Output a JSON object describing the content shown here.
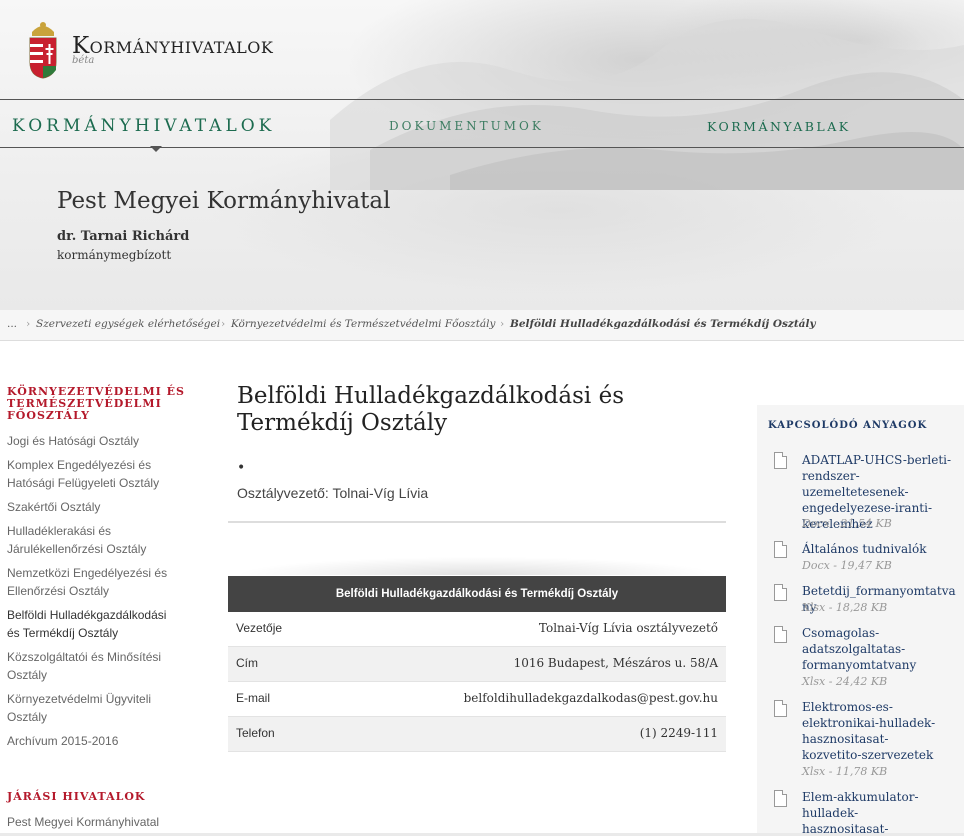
{
  "brand": {
    "name": "Kormányhivatalok",
    "beta": "béta"
  },
  "nav": {
    "items": [
      "Kormányhivatalok",
      "Dokumentumok",
      "Kormányablak"
    ]
  },
  "office": {
    "title": "Pest Megyei Kormányhivatal",
    "head": "dr. Tarnai Richárd",
    "role": "kormánymegbízott"
  },
  "breadcrumb": {
    "items": [
      "...",
      "Szervezeti egységek elérhetőségei",
      "Környezetvédelmi és Természetvédelmi Főosztály",
      "Belföldi Hulladékgazdálkodási és Termékdíj Osztály"
    ]
  },
  "sidebar": {
    "title_lines": [
      "Környezetvédelmi és",
      "Természetvédelmi",
      "Főosztály"
    ],
    "items": [
      {
        "label": "Jogi és Hatósági Osztály"
      },
      {
        "label": "Komplex Engedélyezési és Hatósági Felügyeleti Osztály"
      },
      {
        "label": "Szakértői Osztály"
      },
      {
        "label": "Hulladéklerakási és Járulékellenőrzési Osztály"
      },
      {
        "label": "Nemzetközi Engedélyezési és Ellenőrzési Osztály"
      },
      {
        "label": "Belföldi Hulladékgazdálkodási és Termékdíj Osztály"
      },
      {
        "label": "Közszolgáltatói és Minősítési Osztály"
      },
      {
        "label": "Környezetvédelmi Ügyviteli Osztály"
      },
      {
        "label": "Archívum 2015-2016"
      }
    ],
    "section2_title": "Járási hivatalok",
    "section2_items": [
      {
        "label": "Pest Megyei Kormányhivatal"
      }
    ]
  },
  "main": {
    "title": "Belföldi Hulladékgazdálkodási és Termékdíj Osztály",
    "bullet": "•",
    "manager": "Osztályvezető: Tolnai-Víg Lívia"
  },
  "info_table": {
    "header": "Belföldi Hulladékgazdálkodási és Termékdíj Osztály",
    "rows": [
      {
        "key": "Vezetője",
        "value": "Tolnai-Víg Lívia osztályvezető"
      },
      {
        "key": "Cím",
        "value": "1016 Budapest, Mészáros u. 58/A"
      },
      {
        "key": "E-mail",
        "value": "belfoldihulladekgazdalkodas@pest.gov.hu"
      },
      {
        "key": "Telefon",
        "value": "(1) 2249-111"
      }
    ]
  },
  "related": {
    "title": "Kapcsolódó anyagok",
    "items": [
      {
        "name": "ADATLAP-UHCS-berleti-rendszer-uzemeltetesenek-engedelyezese-iranti-kerelemhez",
        "meta": "Docx - 21,54 KB"
      },
      {
        "name": "Általános tudnivalók",
        "meta": "Docx - 19,47 KB"
      },
      {
        "name": "Betetdij_formanyomtatvany",
        "meta": "Xlsx - 18,28 KB"
      },
      {
        "name": "Csomagolas-adatszolgaltatas-formanyomtatvany",
        "meta": "Xlsx - 24,42 KB"
      },
      {
        "name": "Elektromos-es-elektronikai-hulladek-hasznositasat-kozvetito-szervezetek",
        "meta": "Xlsx - 11,78 KB"
      },
      {
        "name": "Elem-akkumulator-hulladek-hasznositasat-kozvetito-szervezetek-",
        "meta": ""
      }
    ]
  }
}
